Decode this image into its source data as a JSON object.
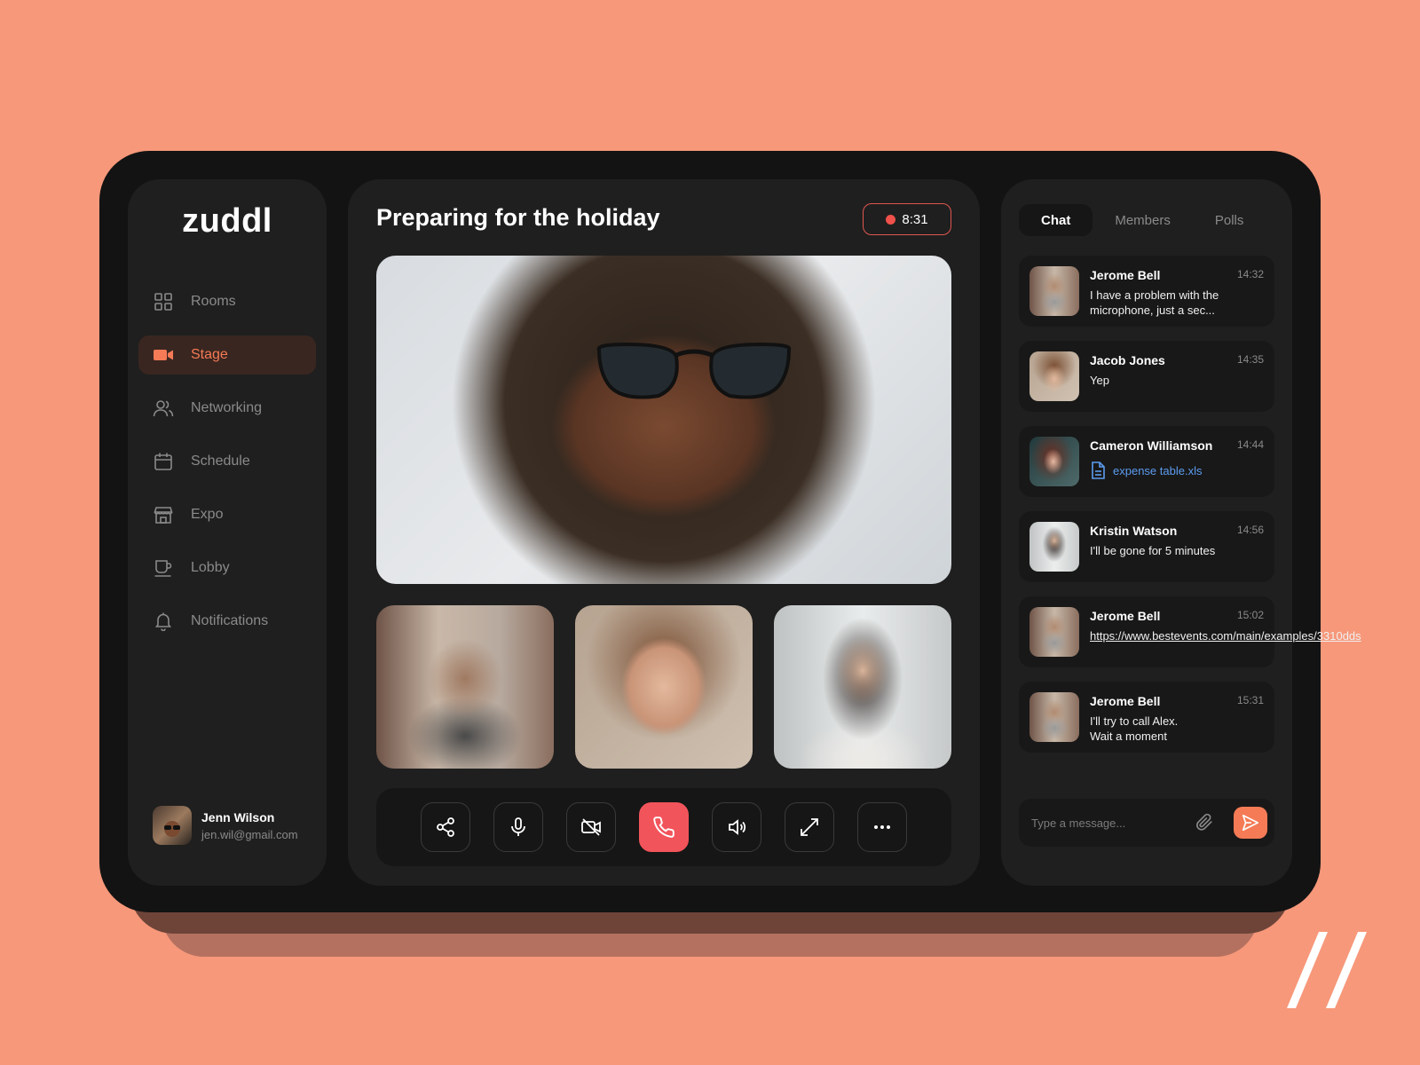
{
  "app": {
    "logo": "zuddl"
  },
  "sidebar": {
    "items": [
      {
        "label": "Rooms",
        "icon": "grid-icon",
        "active": false
      },
      {
        "label": "Stage",
        "icon": "video-camera-icon",
        "active": true
      },
      {
        "label": "Networking",
        "icon": "users-icon",
        "active": false
      },
      {
        "label": "Schedule",
        "icon": "calendar-icon",
        "active": false
      },
      {
        "label": "Expo",
        "icon": "store-icon",
        "active": false
      },
      {
        "label": "Lobby",
        "icon": "coffee-cup-icon",
        "active": false
      },
      {
        "label": "Notifications",
        "icon": "bell-icon",
        "active": false
      }
    ],
    "user": {
      "name": "Jenn Wilson",
      "email": "jen.wil@gmail.com"
    }
  },
  "stage": {
    "title": "Preparing for the holiday",
    "timer": "8:31",
    "controls": [
      "share-icon",
      "microphone-icon",
      "camera-off-icon",
      "end-call-icon",
      "speaker-icon",
      "fullscreen-icon",
      "more-icon"
    ]
  },
  "chat": {
    "tabs": [
      {
        "label": "Chat",
        "active": true
      },
      {
        "label": "Members",
        "active": false
      },
      {
        "label": "Polls",
        "active": false
      }
    ],
    "messages": [
      {
        "name": "Jerome Bell",
        "time": "14:32",
        "text": "I have a problem with the microphone, just a sec..."
      },
      {
        "name": "Jacob Jones",
        "time": "14:35",
        "text": "Yep"
      },
      {
        "name": "Cameron Williamson",
        "time": "14:44",
        "file": "expense table.xls"
      },
      {
        "name": "Kristin Watson",
        "time": "14:56",
        "text": "I'll be gone for 5 minutes"
      },
      {
        "name": "Jerome Bell",
        "time": "15:02",
        "link": "https://www.bestevents.com/main/examples/3310dds"
      },
      {
        "name": "Jerome Bell",
        "time": "15:31",
        "text_line1": "I'll try to call Alex.",
        "text_line2": "Wait a moment"
      }
    ],
    "composer_placeholder": "Type a message..."
  },
  "colors": {
    "background": "#F7987A",
    "accent": "#F47B56",
    "end_call": "#F2545B",
    "file_link": "#5C9CF0"
  }
}
